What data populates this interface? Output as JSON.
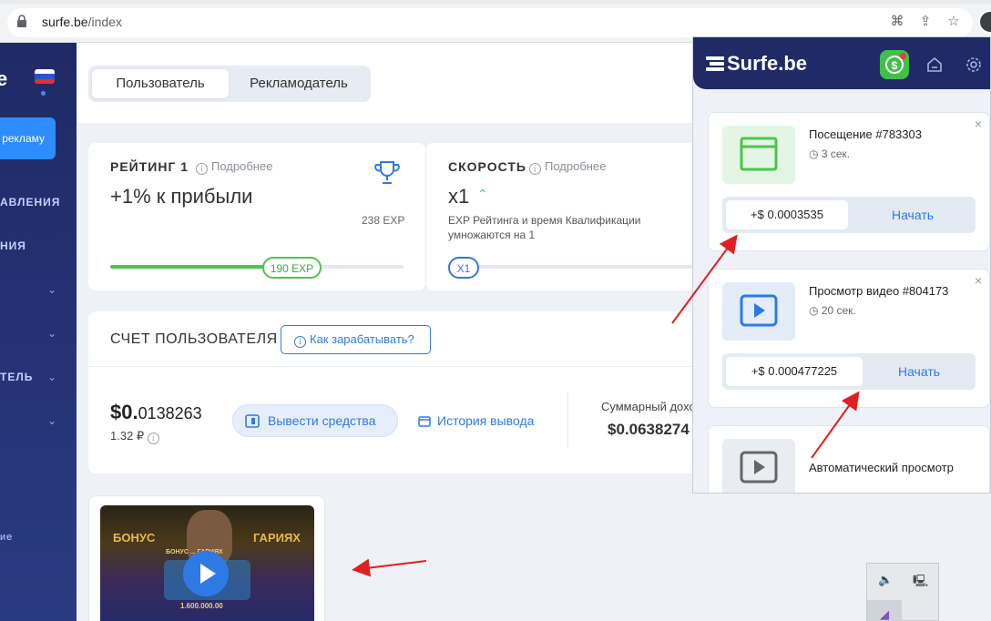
{
  "browser": {
    "url_host": "surfe.be",
    "url_path": "/index"
  },
  "sidebar": {
    "logo": "e",
    "button_label": "рекламу",
    "items": [
      "АВЛЕНИЯ",
      "НИЯ",
      "",
      "",
      "ТЕЛЬ",
      "",
      "ие"
    ]
  },
  "tabs": [
    {
      "label": "Пользователь",
      "active": true
    },
    {
      "label": "Рекламодатель",
      "active": false
    }
  ],
  "rating": {
    "title": "РЕЙТИНГ 1",
    "more": "Подробнее",
    "value": "+1% к прибыли",
    "exp_target": "238 EXP",
    "exp_current": "190 EXP",
    "progress": 0.53
  },
  "speed": {
    "title": "СКОРОСТЬ",
    "more": "Подробнее",
    "value": "x1",
    "description": "EXP Рейтинга и время Квалификации умножаются на 1",
    "badge": "X1"
  },
  "account": {
    "title": "СЧЕТ ПОЛЬЗОВАТЕЛЯ",
    "how_button": "Как зарабатывать?",
    "balance_main": "$0.",
    "balance_fraction": "0138263",
    "balance_rub": "1.32 ₽",
    "withdraw_button": "Вывести средства",
    "history_link": "История вывода",
    "total_label": "Суммарный дохо",
    "total_value": "$0.0638274"
  },
  "popup": {
    "logo": "Surfe.be",
    "tasks": [
      {
        "title": "Посещение #783303",
        "time": "3 сек.",
        "price": "+$ 0.0003535",
        "action": "Начать",
        "thumb": "browser-window-icon",
        "thumb_bg": "#e3f6e6"
      },
      {
        "title": "Просмотр видео #804173",
        "time": "20 сек.",
        "price": "+$ 0.000477225",
        "action": "Начать",
        "thumb": "play-icon",
        "thumb_bg": "#e4ecf8"
      },
      {
        "title": "Автоматический просмотр",
        "time": "",
        "price": "",
        "action": "",
        "thumb": "play-icon-gray",
        "thumb_bg": "#e9ecf1"
      }
    ]
  },
  "video_card": {
    "overlay_text_left": "БОНУС",
    "overlay_text_right": "ГАРИЯХ",
    "overlay_small": "БОНУС ... ГАРИЯХ",
    "overlay_number": "1.600.000.00"
  },
  "colors": {
    "accent": "#2d7ae5",
    "sidebar": "#1f2a66",
    "green": "#4cc44c",
    "arrow": "#e02020"
  }
}
